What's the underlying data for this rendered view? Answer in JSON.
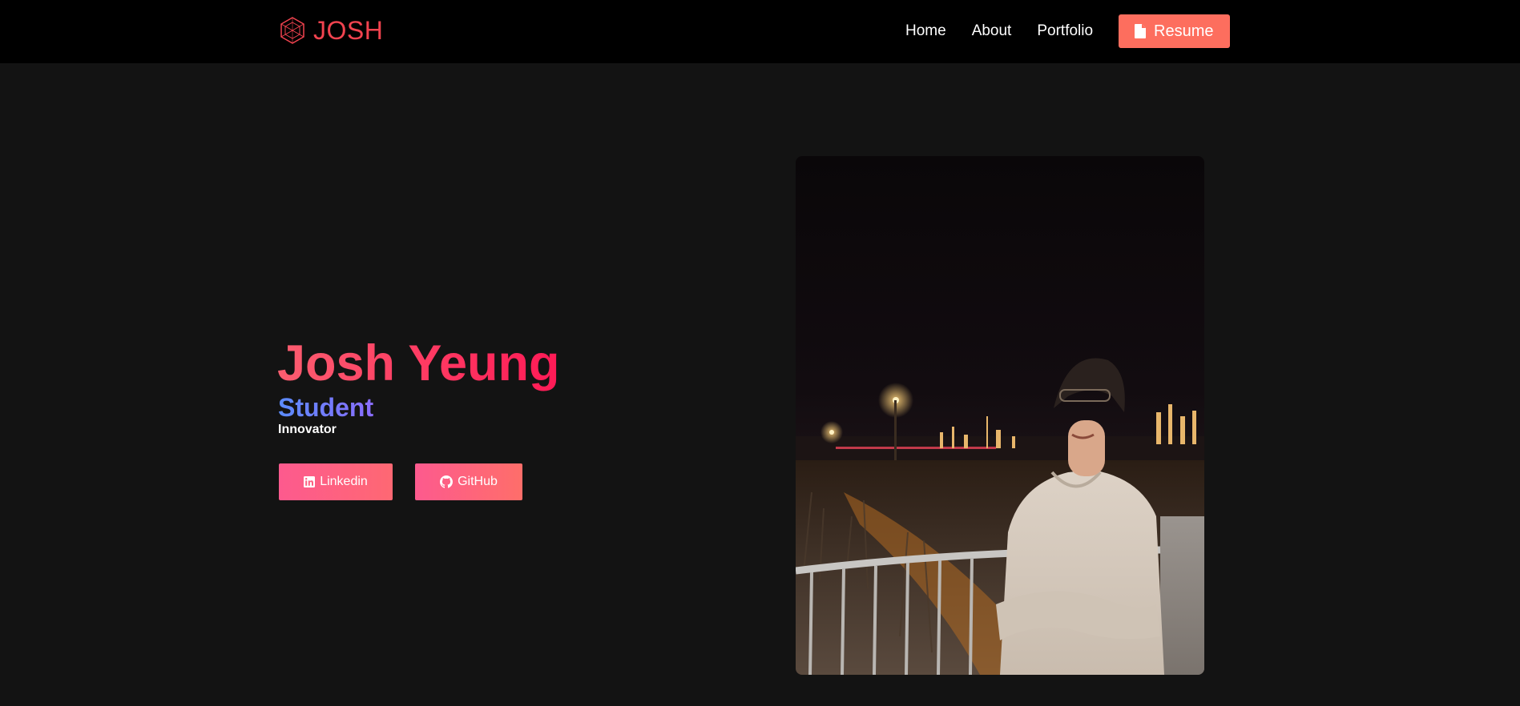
{
  "nav": {
    "brand": "JOSH",
    "brand_icon": "hexagon-logo-icon",
    "links": [
      "Home",
      "About",
      "Portfolio"
    ],
    "resume_label": "Resume",
    "resume_icon": "document-icon"
  },
  "hero": {
    "name": "Josh Yeung",
    "role": "Student",
    "subtitle": "Innovator",
    "buttons": {
      "linkedin_label": "Linkedin",
      "linkedin_icon": "linkedin-icon",
      "github_label": "GitHub",
      "github_icon": "github-icon"
    }
  },
  "photo": {
    "subject": "portrait-photo"
  },
  "colors": {
    "nav_bg": "#000000",
    "page_bg": "#131313",
    "brand": "#f1434f",
    "accent": "#fd6e5e",
    "name_gradient_start": "#fc5e70",
    "name_gradient_end": "#ff1a56",
    "role_gradient_start": "#5b8cff",
    "role_gradient_end": "#8a6dff",
    "button_gradient_start": "#fd5a8e",
    "button_gradient_end": "#fe6873"
  }
}
